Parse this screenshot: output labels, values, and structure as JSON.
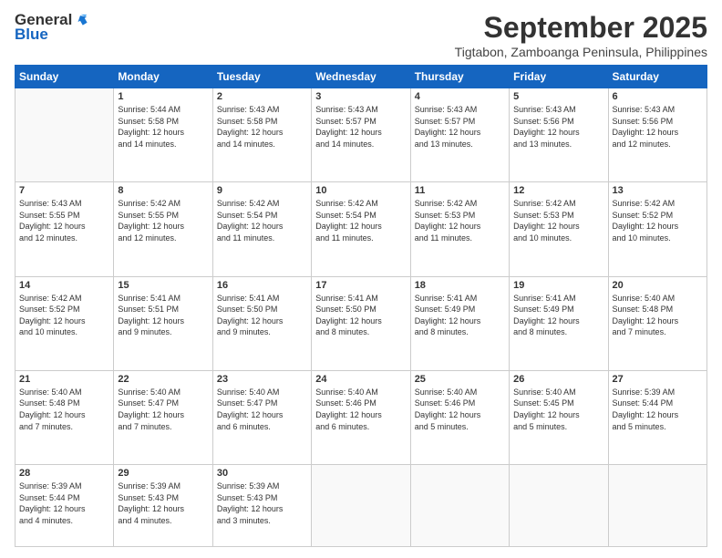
{
  "header": {
    "logo": {
      "line1": "General",
      "line2": "Blue"
    },
    "title": "September 2025",
    "subtitle": "Tigtabon, Zamboanga Peninsula, Philippines"
  },
  "weekdays": [
    "Sunday",
    "Monday",
    "Tuesday",
    "Wednesday",
    "Thursday",
    "Friday",
    "Saturday"
  ],
  "weeks": [
    [
      {
        "day": "",
        "info": ""
      },
      {
        "day": "1",
        "info": "Sunrise: 5:44 AM\nSunset: 5:58 PM\nDaylight: 12 hours\nand 14 minutes."
      },
      {
        "day": "2",
        "info": "Sunrise: 5:43 AM\nSunset: 5:58 PM\nDaylight: 12 hours\nand 14 minutes."
      },
      {
        "day": "3",
        "info": "Sunrise: 5:43 AM\nSunset: 5:57 PM\nDaylight: 12 hours\nand 14 minutes."
      },
      {
        "day": "4",
        "info": "Sunrise: 5:43 AM\nSunset: 5:57 PM\nDaylight: 12 hours\nand 13 minutes."
      },
      {
        "day": "5",
        "info": "Sunrise: 5:43 AM\nSunset: 5:56 PM\nDaylight: 12 hours\nand 13 minutes."
      },
      {
        "day": "6",
        "info": "Sunrise: 5:43 AM\nSunset: 5:56 PM\nDaylight: 12 hours\nand 12 minutes."
      }
    ],
    [
      {
        "day": "7",
        "info": "Sunrise: 5:43 AM\nSunset: 5:55 PM\nDaylight: 12 hours\nand 12 minutes."
      },
      {
        "day": "8",
        "info": "Sunrise: 5:42 AM\nSunset: 5:55 PM\nDaylight: 12 hours\nand 12 minutes."
      },
      {
        "day": "9",
        "info": "Sunrise: 5:42 AM\nSunset: 5:54 PM\nDaylight: 12 hours\nand 11 minutes."
      },
      {
        "day": "10",
        "info": "Sunrise: 5:42 AM\nSunset: 5:54 PM\nDaylight: 12 hours\nand 11 minutes."
      },
      {
        "day": "11",
        "info": "Sunrise: 5:42 AM\nSunset: 5:53 PM\nDaylight: 12 hours\nand 11 minutes."
      },
      {
        "day": "12",
        "info": "Sunrise: 5:42 AM\nSunset: 5:53 PM\nDaylight: 12 hours\nand 10 minutes."
      },
      {
        "day": "13",
        "info": "Sunrise: 5:42 AM\nSunset: 5:52 PM\nDaylight: 12 hours\nand 10 minutes."
      }
    ],
    [
      {
        "day": "14",
        "info": "Sunrise: 5:42 AM\nSunset: 5:52 PM\nDaylight: 12 hours\nand 10 minutes."
      },
      {
        "day": "15",
        "info": "Sunrise: 5:41 AM\nSunset: 5:51 PM\nDaylight: 12 hours\nand 9 minutes."
      },
      {
        "day": "16",
        "info": "Sunrise: 5:41 AM\nSunset: 5:50 PM\nDaylight: 12 hours\nand 9 minutes."
      },
      {
        "day": "17",
        "info": "Sunrise: 5:41 AM\nSunset: 5:50 PM\nDaylight: 12 hours\nand 8 minutes."
      },
      {
        "day": "18",
        "info": "Sunrise: 5:41 AM\nSunset: 5:49 PM\nDaylight: 12 hours\nand 8 minutes."
      },
      {
        "day": "19",
        "info": "Sunrise: 5:41 AM\nSunset: 5:49 PM\nDaylight: 12 hours\nand 8 minutes."
      },
      {
        "day": "20",
        "info": "Sunrise: 5:40 AM\nSunset: 5:48 PM\nDaylight: 12 hours\nand 7 minutes."
      }
    ],
    [
      {
        "day": "21",
        "info": "Sunrise: 5:40 AM\nSunset: 5:48 PM\nDaylight: 12 hours\nand 7 minutes."
      },
      {
        "day": "22",
        "info": "Sunrise: 5:40 AM\nSunset: 5:47 PM\nDaylight: 12 hours\nand 7 minutes."
      },
      {
        "day": "23",
        "info": "Sunrise: 5:40 AM\nSunset: 5:47 PM\nDaylight: 12 hours\nand 6 minutes."
      },
      {
        "day": "24",
        "info": "Sunrise: 5:40 AM\nSunset: 5:46 PM\nDaylight: 12 hours\nand 6 minutes."
      },
      {
        "day": "25",
        "info": "Sunrise: 5:40 AM\nSunset: 5:46 PM\nDaylight: 12 hours\nand 5 minutes."
      },
      {
        "day": "26",
        "info": "Sunrise: 5:40 AM\nSunset: 5:45 PM\nDaylight: 12 hours\nand 5 minutes."
      },
      {
        "day": "27",
        "info": "Sunrise: 5:39 AM\nSunset: 5:44 PM\nDaylight: 12 hours\nand 5 minutes."
      }
    ],
    [
      {
        "day": "28",
        "info": "Sunrise: 5:39 AM\nSunset: 5:44 PM\nDaylight: 12 hours\nand 4 minutes."
      },
      {
        "day": "29",
        "info": "Sunrise: 5:39 AM\nSunset: 5:43 PM\nDaylight: 12 hours\nand 4 minutes."
      },
      {
        "day": "30",
        "info": "Sunrise: 5:39 AM\nSunset: 5:43 PM\nDaylight: 12 hours\nand 3 minutes."
      },
      {
        "day": "",
        "info": ""
      },
      {
        "day": "",
        "info": ""
      },
      {
        "day": "",
        "info": ""
      },
      {
        "day": "",
        "info": ""
      }
    ]
  ]
}
